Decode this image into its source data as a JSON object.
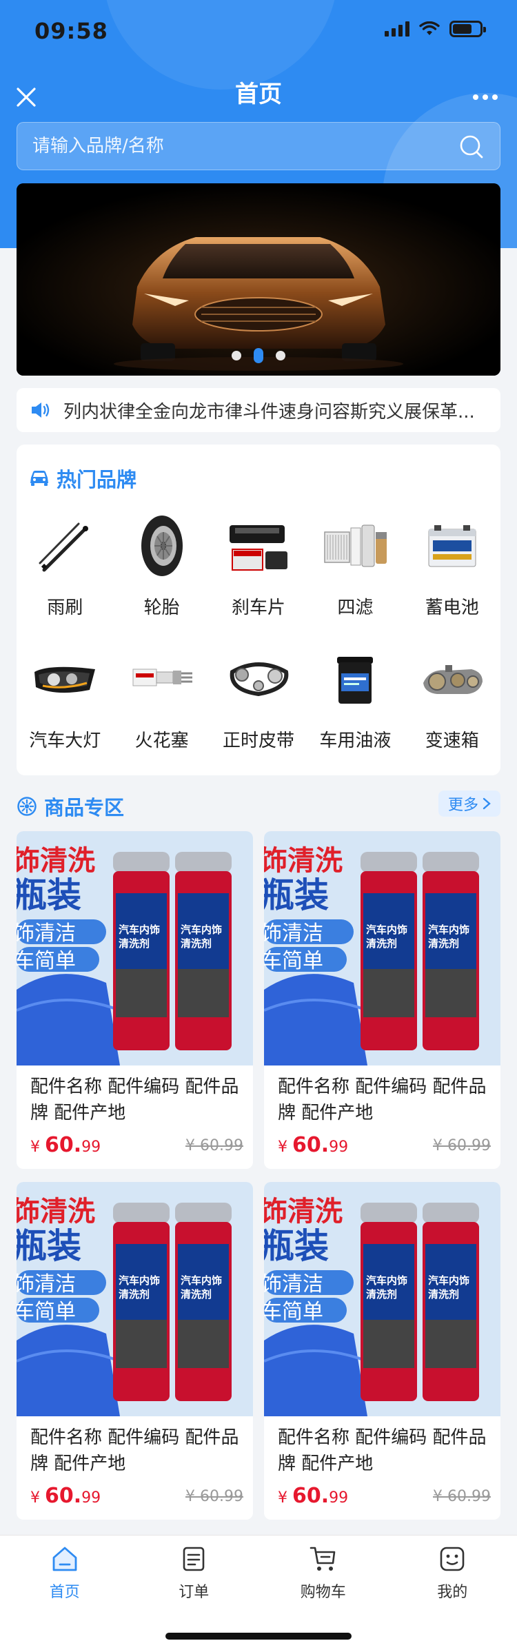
{
  "status": {
    "time": "09:58"
  },
  "nav": {
    "title": "首页"
  },
  "search": {
    "placeholder": "请输入品牌/名称"
  },
  "notice": {
    "text": "列内状律全金向龙市律斗件速身问容斯究义展保革..."
  },
  "brands": {
    "title": "热门品牌",
    "items": [
      {
        "label": "雨刷",
        "icon": "wiper-icon"
      },
      {
        "label": "轮胎",
        "icon": "tire-icon"
      },
      {
        "label": "刹车片",
        "icon": "brake-pad-icon"
      },
      {
        "label": "四滤",
        "icon": "filter-icon"
      },
      {
        "label": "蓄电池",
        "icon": "battery-icon"
      },
      {
        "label": "汽车大灯",
        "icon": "headlight-icon"
      },
      {
        "label": "火花塞",
        "icon": "spark-plug-icon"
      },
      {
        "label": "正时皮带",
        "icon": "timing-belt-icon"
      },
      {
        "label": "车用油液",
        "icon": "oil-bucket-icon"
      },
      {
        "label": "变速箱",
        "icon": "gearbox-icon"
      }
    ]
  },
  "products": {
    "title": "商品专区",
    "more": "更多",
    "items": [
      {
        "name": "配件名称 配件编码 配件品牌 配件产地",
        "currency": "¥",
        "price_int": "60.",
        "price_dec": "99",
        "orig": "¥ 60.99"
      },
      {
        "name": "配件名称 配件编码 配件品牌 配件产地",
        "currency": "¥",
        "price_int": "60.",
        "price_dec": "99",
        "orig": "¥ 60.99"
      },
      {
        "name": "配件名称 配件编码 配件品牌 配件产地",
        "currency": "¥",
        "price_int": "60.",
        "price_dec": "99",
        "orig": "¥ 60.99"
      },
      {
        "name": "配件名称 配件编码 配件品牌 配件产地",
        "currency": "¥",
        "price_int": "60.",
        "price_dec": "99",
        "orig": "¥ 60.99"
      }
    ],
    "image_text": {
      "line1": "饰清洗",
      "line2": "瓶装",
      "line3": "饰清洁",
      "line4": "车简单",
      "can_label_1": "汽车内饰",
      "can_label_2": "清洗剂"
    }
  },
  "tabbar": {
    "items": [
      {
        "label": "首页",
        "icon": "home-icon",
        "active": true
      },
      {
        "label": "订单",
        "icon": "order-icon",
        "active": false
      },
      {
        "label": "购物车",
        "icon": "cart-icon",
        "active": false
      },
      {
        "label": "我的",
        "icon": "profile-icon",
        "active": false
      }
    ]
  },
  "colors": {
    "primary": "#2e8bf2",
    "price": "#e6182e"
  }
}
